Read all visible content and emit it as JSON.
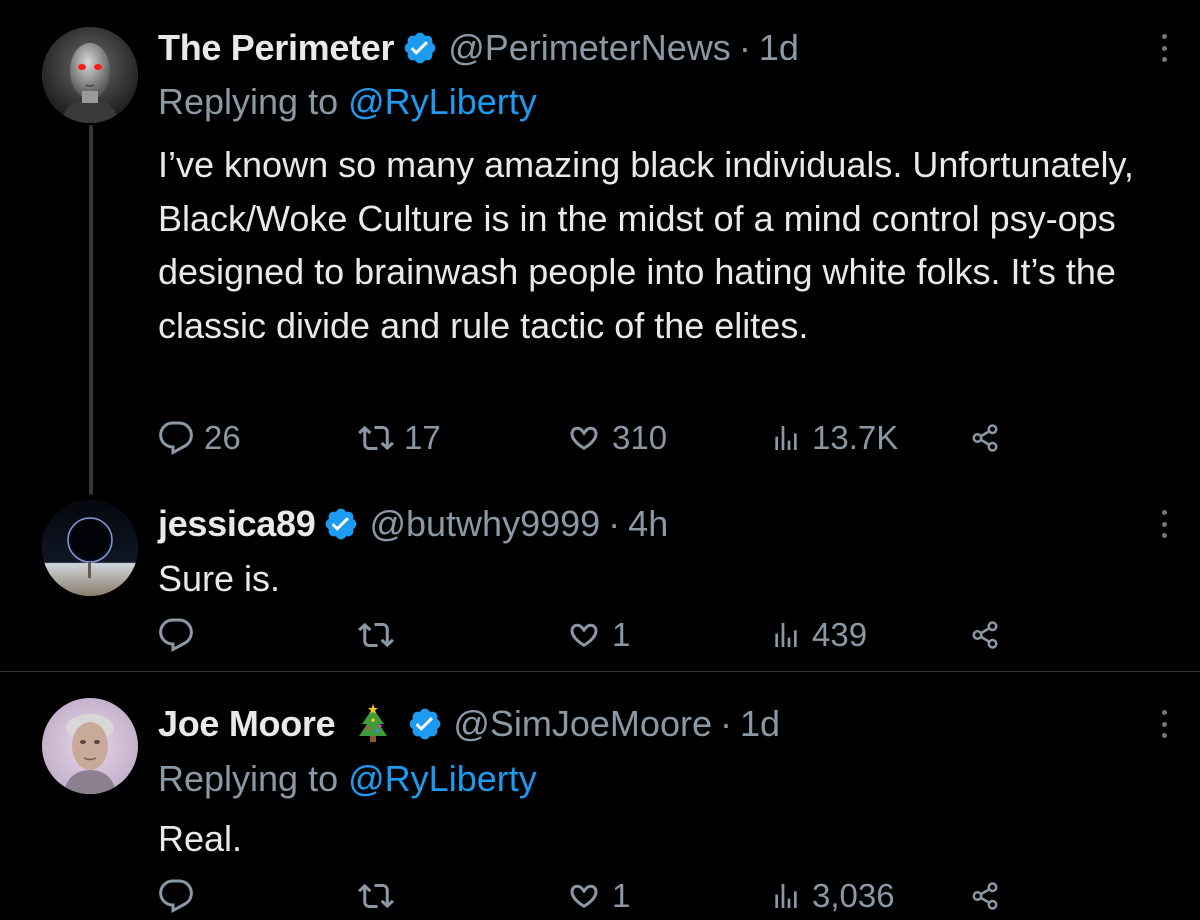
{
  "tweets": [
    {
      "display_name": "The Perimeter",
      "verified": true,
      "handle": "@PerimeterNews",
      "separator": "·",
      "time": "1d",
      "replying_prefix": "Replying to",
      "replying_to": "@RyLiberty",
      "text": "I’ve known so many amazing black individuals. Unfortunately, Black/Woke Culture is in the midst of a mind control psy-ops designed to brainwash people into hating white folks. It’s the classic divide and rule tactic of the elites.",
      "replies": "26",
      "retweets": "17",
      "likes": "310",
      "views": "13.7K"
    },
    {
      "display_name": "jessica89",
      "verified": true,
      "handle": "@butwhy9999",
      "separator": "·",
      "time": "4h",
      "text": "Sure is.",
      "replies": "",
      "retweets": "",
      "likes": "1",
      "views": "439"
    },
    {
      "display_name": "Joe Moore",
      "emoji": "christmas-tree-emoji",
      "verified": true,
      "handle": "@SimJoeMoore",
      "separator": "·",
      "time": "1d",
      "replying_prefix": "Replying to",
      "replying_to": "@RyLiberty",
      "text": "Real.",
      "replies": "",
      "retweets": "",
      "likes": "1",
      "views": "3,036"
    }
  ],
  "icons": {
    "reply": "reply-icon",
    "retweet": "retweet-icon",
    "like": "heart-icon",
    "views": "views-icon",
    "share": "share-icon",
    "verified": "verified-badge-icon",
    "more": "more-options-icon"
  },
  "colors": {
    "background": "#000000",
    "text": "#e7e9ea",
    "secondary": "#8b98a5",
    "accent": "#1d9bf0",
    "divider": "#2f3336"
  }
}
